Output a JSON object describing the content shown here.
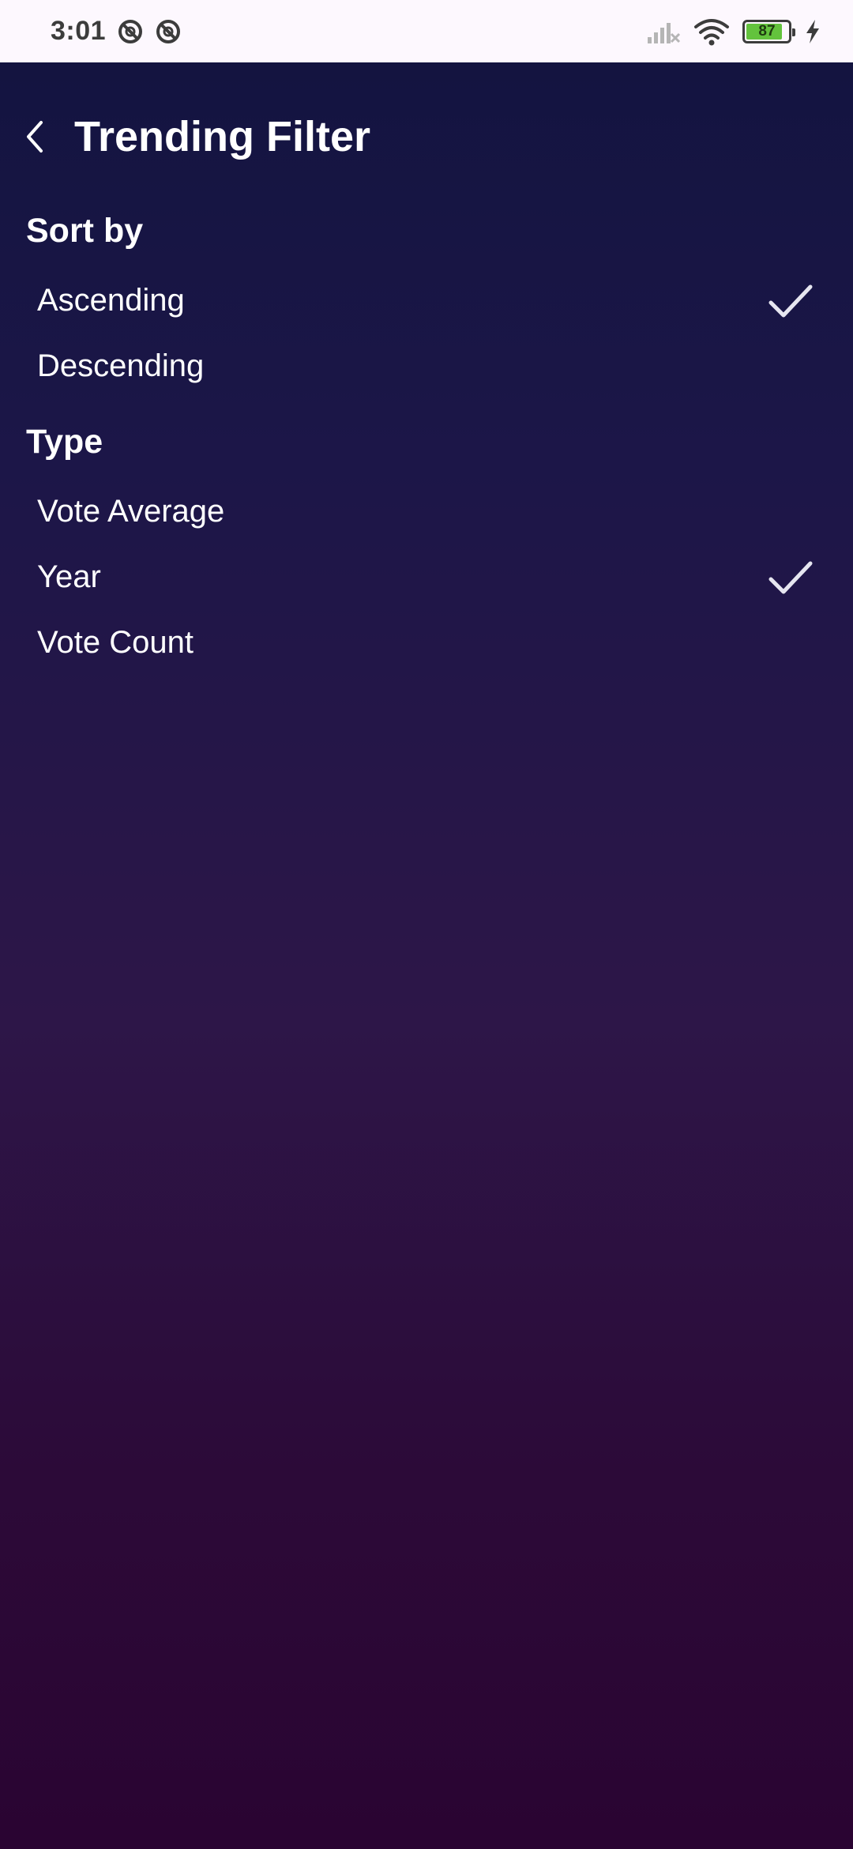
{
  "status_bar": {
    "time": "3:01",
    "battery_level": "87",
    "battery_fraction": 0.87,
    "charging": true
  },
  "app_bar": {
    "title": "Trending Filter",
    "back_icon": "chevron-left-icon"
  },
  "sort_by": {
    "header": "Sort by",
    "options": [
      {
        "label": "Ascending",
        "selected": true
      },
      {
        "label": "Descending",
        "selected": false
      }
    ]
  },
  "type": {
    "header": "Type",
    "options": [
      {
        "label": "Vote Average",
        "selected": false
      },
      {
        "label": "Year",
        "selected": true
      },
      {
        "label": "Vote Count",
        "selected": false
      }
    ]
  },
  "colors": {
    "background_top": "#12143f",
    "background_bottom": "#2a0432",
    "text": "#ffffff",
    "check": "#e6e6f0",
    "status_bar_bg": "#fdf8fe",
    "battery_green": "#63c33d"
  }
}
